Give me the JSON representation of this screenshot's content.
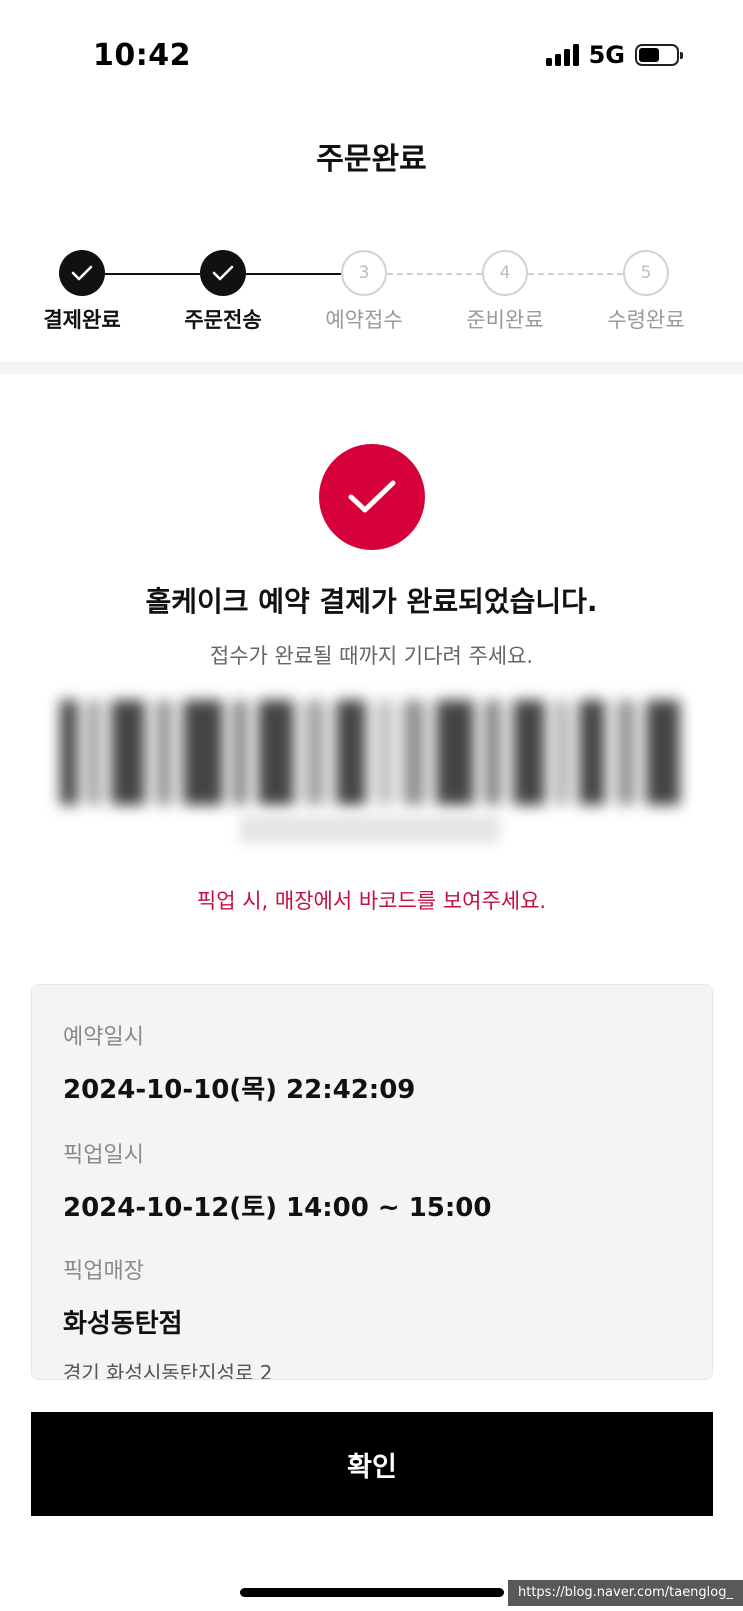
{
  "status_bar": {
    "time": "10:42",
    "network": "5G",
    "battery_level": 0.56,
    "signal_bars": 4
  },
  "header": {
    "title": "주문완료"
  },
  "stepper": {
    "steps": [
      {
        "number": "1",
        "label": "결제완료",
        "state": "done"
      },
      {
        "number": "2",
        "label": "주문전송",
        "state": "done"
      },
      {
        "number": "3",
        "label": "예약접수",
        "state": "todo"
      },
      {
        "number": "4",
        "label": "준비완료",
        "state": "todo"
      },
      {
        "number": "5",
        "label": "수령완료",
        "state": "todo"
      }
    ]
  },
  "success": {
    "title": "홀케이크 예약 결제가 완료되었습니다.",
    "subtitle": "접수가 완료될 때까지 기다려 주세요.",
    "pickup_notice": "픽업 시, 매장에서 바코드를 보여주세요."
  },
  "info": {
    "reservation_label": "예약일시",
    "reservation_value": "2024-10-10(목) 22:42:09",
    "pickup_time_label": "픽업일시",
    "pickup_time_value": "2024-10-12(토) 14:00 ~ 15:00",
    "pickup_store_label": "픽업매장",
    "pickup_store_value": "화성동탄점",
    "pickup_store_address": "경기 화성시동탄지성로 2"
  },
  "actions": {
    "confirm_label": "확인"
  },
  "watermark": "https://blog.naver.com/taenglog_",
  "colors": {
    "accent": "#d6003a",
    "notice": "#c8103f",
    "done": "#111111",
    "todo": "#d2d2d2"
  }
}
